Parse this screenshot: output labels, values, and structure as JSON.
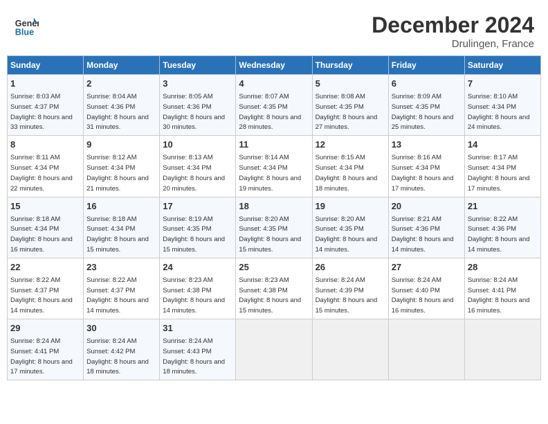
{
  "header": {
    "logo_text_general": "General",
    "logo_text_blue": "Blue",
    "month_year": "December 2024",
    "location": "Drulingen, France"
  },
  "weekdays": [
    "Sunday",
    "Monday",
    "Tuesday",
    "Wednesday",
    "Thursday",
    "Friday",
    "Saturday"
  ],
  "weeks": [
    [
      {
        "day": "1",
        "sunrise": "Sunrise: 8:03 AM",
        "sunset": "Sunset: 4:37 PM",
        "daylight": "Daylight: 8 hours and 33 minutes."
      },
      {
        "day": "2",
        "sunrise": "Sunrise: 8:04 AM",
        "sunset": "Sunset: 4:36 PM",
        "daylight": "Daylight: 8 hours and 31 minutes."
      },
      {
        "day": "3",
        "sunrise": "Sunrise: 8:05 AM",
        "sunset": "Sunset: 4:36 PM",
        "daylight": "Daylight: 8 hours and 30 minutes."
      },
      {
        "day": "4",
        "sunrise": "Sunrise: 8:07 AM",
        "sunset": "Sunset: 4:35 PM",
        "daylight": "Daylight: 8 hours and 28 minutes."
      },
      {
        "day": "5",
        "sunrise": "Sunrise: 8:08 AM",
        "sunset": "Sunset: 4:35 PM",
        "daylight": "Daylight: 8 hours and 27 minutes."
      },
      {
        "day": "6",
        "sunrise": "Sunrise: 8:09 AM",
        "sunset": "Sunset: 4:35 PM",
        "daylight": "Daylight: 8 hours and 25 minutes."
      },
      {
        "day": "7",
        "sunrise": "Sunrise: 8:10 AM",
        "sunset": "Sunset: 4:34 PM",
        "daylight": "Daylight: 8 hours and 24 minutes."
      }
    ],
    [
      {
        "day": "8",
        "sunrise": "Sunrise: 8:11 AM",
        "sunset": "Sunset: 4:34 PM",
        "daylight": "Daylight: 8 hours and 22 minutes."
      },
      {
        "day": "9",
        "sunrise": "Sunrise: 8:12 AM",
        "sunset": "Sunset: 4:34 PM",
        "daylight": "Daylight: 8 hours and 21 minutes."
      },
      {
        "day": "10",
        "sunrise": "Sunrise: 8:13 AM",
        "sunset": "Sunset: 4:34 PM",
        "daylight": "Daylight: 8 hours and 20 minutes."
      },
      {
        "day": "11",
        "sunrise": "Sunrise: 8:14 AM",
        "sunset": "Sunset: 4:34 PM",
        "daylight": "Daylight: 8 hours and 19 minutes."
      },
      {
        "day": "12",
        "sunrise": "Sunrise: 8:15 AM",
        "sunset": "Sunset: 4:34 PM",
        "daylight": "Daylight: 8 hours and 18 minutes."
      },
      {
        "day": "13",
        "sunrise": "Sunrise: 8:16 AM",
        "sunset": "Sunset: 4:34 PM",
        "daylight": "Daylight: 8 hours and 17 minutes."
      },
      {
        "day": "14",
        "sunrise": "Sunrise: 8:17 AM",
        "sunset": "Sunset: 4:34 PM",
        "daylight": "Daylight: 8 hours and 17 minutes."
      }
    ],
    [
      {
        "day": "15",
        "sunrise": "Sunrise: 8:18 AM",
        "sunset": "Sunset: 4:34 PM",
        "daylight": "Daylight: 8 hours and 16 minutes."
      },
      {
        "day": "16",
        "sunrise": "Sunrise: 8:18 AM",
        "sunset": "Sunset: 4:34 PM",
        "daylight": "Daylight: 8 hours and 15 minutes."
      },
      {
        "day": "17",
        "sunrise": "Sunrise: 8:19 AM",
        "sunset": "Sunset: 4:35 PM",
        "daylight": "Daylight: 8 hours and 15 minutes."
      },
      {
        "day": "18",
        "sunrise": "Sunrise: 8:20 AM",
        "sunset": "Sunset: 4:35 PM",
        "daylight": "Daylight: 8 hours and 15 minutes."
      },
      {
        "day": "19",
        "sunrise": "Sunrise: 8:20 AM",
        "sunset": "Sunset: 4:35 PM",
        "daylight": "Daylight: 8 hours and 14 minutes."
      },
      {
        "day": "20",
        "sunrise": "Sunrise: 8:21 AM",
        "sunset": "Sunset: 4:36 PM",
        "daylight": "Daylight: 8 hours and 14 minutes."
      },
      {
        "day": "21",
        "sunrise": "Sunrise: 8:22 AM",
        "sunset": "Sunset: 4:36 PM",
        "daylight": "Daylight: 8 hours and 14 minutes."
      }
    ],
    [
      {
        "day": "22",
        "sunrise": "Sunrise: 8:22 AM",
        "sunset": "Sunset: 4:37 PM",
        "daylight": "Daylight: 8 hours and 14 minutes."
      },
      {
        "day": "23",
        "sunrise": "Sunrise: 8:22 AM",
        "sunset": "Sunset: 4:37 PM",
        "daylight": "Daylight: 8 hours and 14 minutes."
      },
      {
        "day": "24",
        "sunrise": "Sunrise: 8:23 AM",
        "sunset": "Sunset: 4:38 PM",
        "daylight": "Daylight: 8 hours and 14 minutes."
      },
      {
        "day": "25",
        "sunrise": "Sunrise: 8:23 AM",
        "sunset": "Sunset: 4:38 PM",
        "daylight": "Daylight: 8 hours and 15 minutes."
      },
      {
        "day": "26",
        "sunrise": "Sunrise: 8:24 AM",
        "sunset": "Sunset: 4:39 PM",
        "daylight": "Daylight: 8 hours and 15 minutes."
      },
      {
        "day": "27",
        "sunrise": "Sunrise: 8:24 AM",
        "sunset": "Sunset: 4:40 PM",
        "daylight": "Daylight: 8 hours and 16 minutes."
      },
      {
        "day": "28",
        "sunrise": "Sunrise: 8:24 AM",
        "sunset": "Sunset: 4:41 PM",
        "daylight": "Daylight: 8 hours and 16 minutes."
      }
    ],
    [
      {
        "day": "29",
        "sunrise": "Sunrise: 8:24 AM",
        "sunset": "Sunset: 4:41 PM",
        "daylight": "Daylight: 8 hours and 17 minutes."
      },
      {
        "day": "30",
        "sunrise": "Sunrise: 8:24 AM",
        "sunset": "Sunset: 4:42 PM",
        "daylight": "Daylight: 8 hours and 18 minutes."
      },
      {
        "day": "31",
        "sunrise": "Sunrise: 8:24 AM",
        "sunset": "Sunset: 4:43 PM",
        "daylight": "Daylight: 8 hours and 18 minutes."
      },
      null,
      null,
      null,
      null
    ]
  ]
}
